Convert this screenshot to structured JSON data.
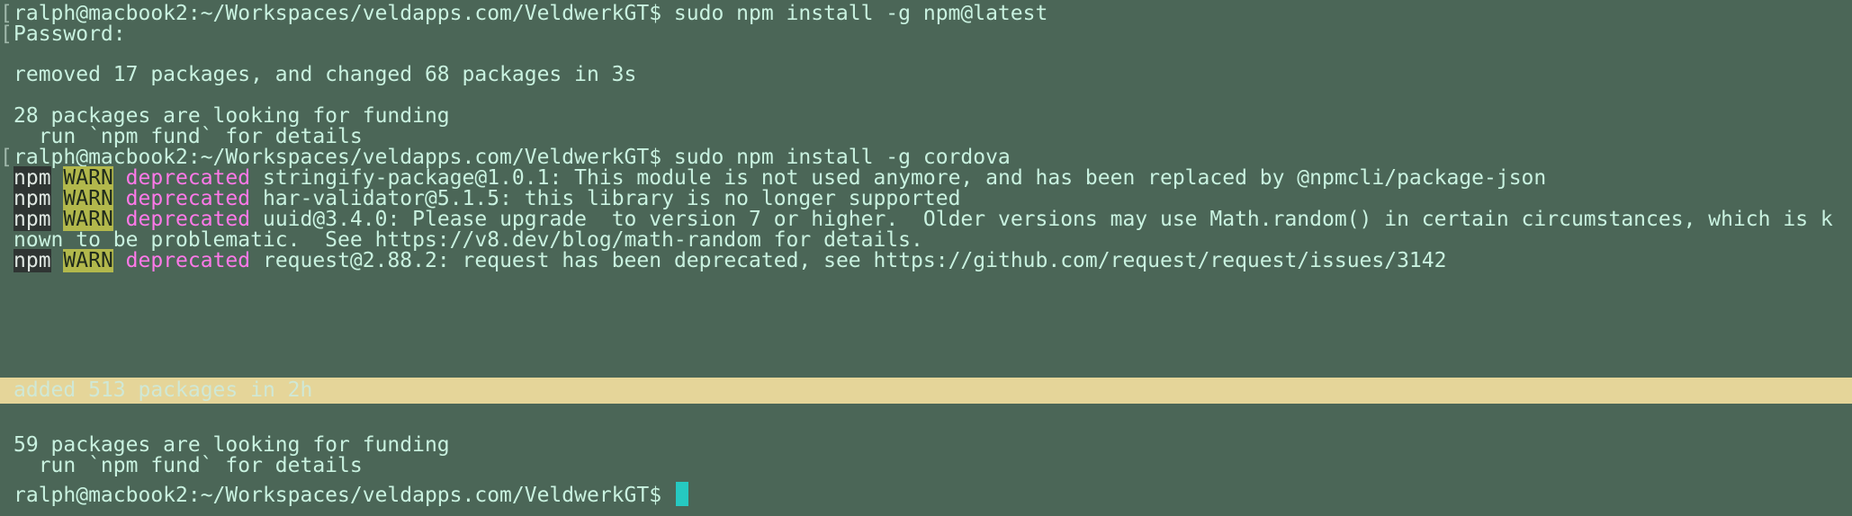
{
  "terminal": {
    "lines": {
      "l1": {
        "marker": "[",
        "text": "ralph@macbook2:~/Workspaces/veldapps.com/VeldwerkGT$ sudo npm install -g npm@latest"
      },
      "l2": {
        "marker": "[",
        "text": "Password:"
      },
      "l3": {
        "text": "removed 17 packages, and changed 68 packages in 3s"
      },
      "l4": {
        "text": "28 packages are looking for funding"
      },
      "l5": {
        "text": "  run `npm fund` for details"
      },
      "l6": {
        "marker": "[",
        "text": "ralph@macbook2:~/Workspaces/veldapps.com/VeldwerkGT$ sudo npm install -g cordova"
      },
      "w1": {
        "npm": "npm",
        "warn": "WARN",
        "dep": "deprecated",
        "msg": " stringify-package@1.0.1: This module is not used anymore, and has been replaced by @npmcli/package-json"
      },
      "w2": {
        "npm": "npm",
        "warn": "WARN",
        "dep": "deprecated",
        "msg": " har-validator@5.1.5: this library is no longer supported"
      },
      "w3": {
        "npm": "npm",
        "warn": "WARN",
        "dep": "deprecated",
        "msg": " uuid@3.4.0: Please upgrade  to version 7 or higher.  Older versions may use Math.random() in certain circumstances, which is k"
      },
      "w3b": {
        "text": "nown to be problematic.  See https://v8.dev/blog/math-random for details."
      },
      "w4": {
        "npm": "npm",
        "warn": "WARN",
        "dep": "deprecated",
        "msg": " request@2.88.2: request has been deprecated, see https://github.com/request/request/issues/3142"
      },
      "l7": {
        "text": "added 513 packages in 2h"
      },
      "l8": {
        "text": "59 packages are looking for funding"
      },
      "l9": {
        "text": "  run `npm fund` for details"
      },
      "l10": {
        "text": "ralph@macbook2:~/Workspaces/veldapps.com/VeldwerkGT$ "
      }
    },
    "colors": {
      "background": "#4b6657",
      "foreground": "#c9f2e0",
      "warn_bg": "#b2b84c",
      "deprecated": "#ff79e9",
      "highlight_bg": "#e5d599",
      "cursor": "#26c9c1"
    }
  }
}
